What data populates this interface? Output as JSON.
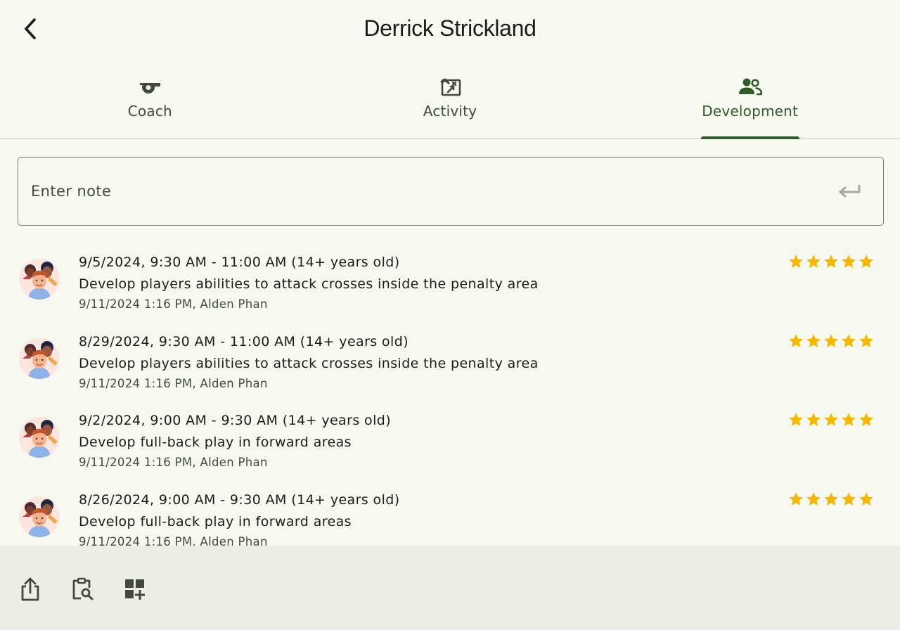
{
  "header": {
    "title": "Derrick Strickland",
    "back_icon": "arrow-back-icon"
  },
  "tabs": [
    {
      "label": "Coach",
      "icon": "whistle-icon",
      "active": false
    },
    {
      "label": "Activity",
      "icon": "tactics-board-icon",
      "active": false
    },
    {
      "label": "Development",
      "icon": "people-icon",
      "active": true
    }
  ],
  "note_input": {
    "placeholder": "Enter note",
    "value": "",
    "submit_icon": "keyboard-return-icon"
  },
  "notes": [
    {
      "date": "9/5/2024, 9:30 AM - 11:00 AM (14+ years old)",
      "text": "Develop players abilities to attack crosses inside the penalty area",
      "meta": "9/11/2024 1:16 PM, Alden Phan",
      "rating": 5,
      "avatar": "group-avatar-icon"
    },
    {
      "date": "8/29/2024, 9:30 AM - 11:00 AM (14+ years old)",
      "text": "Develop players abilities to attack crosses inside the penalty area",
      "meta": "9/11/2024 1:16 PM, Alden Phan",
      "rating": 5,
      "avatar": "group-avatar-icon"
    },
    {
      "date": "9/2/2024, 9:00 AM - 9:30 AM (14+ years old)",
      "text": "Develop full-back play in forward areas",
      "meta": "9/11/2024 1:16 PM, Alden Phan",
      "rating": 5,
      "avatar": "group-avatar-icon"
    },
    {
      "date": "8/26/2024, 9:00 AM - 9:30 AM (14+ years old)",
      "text": "Develop full-back play in forward areas",
      "meta": "9/11/2024 1:16 PM, Alden Phan",
      "rating": 5,
      "avatar": "group-avatar-icon"
    }
  ],
  "bottom_bar": {
    "actions": [
      "share-icon",
      "clipboard-search-icon",
      "add-widget-icon"
    ]
  },
  "colors": {
    "background": "#f7f9f1",
    "accent": "#2f5a29",
    "star": "#f5b800",
    "bottom_bar": "#eceee4",
    "text": "#1b1c18",
    "muted_text": "#44483e"
  }
}
